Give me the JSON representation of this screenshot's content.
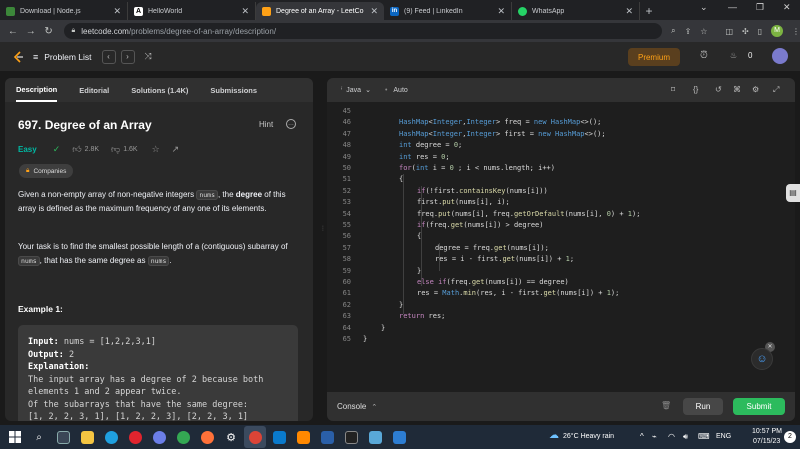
{
  "browser": {
    "tabs": [
      {
        "title": "Download | Node.js",
        "fav_color": "#3c873a"
      },
      {
        "title": "HelloWorld",
        "fav_color": "#ffffff"
      },
      {
        "title": "Degree of an Array - LeetCo",
        "fav_color": "#ffa116",
        "active": true
      },
      {
        "title": "(9) Feed | LinkedIn",
        "fav_color": "#0a66c2"
      },
      {
        "title": "WhatsApp",
        "fav_color": "#25d366"
      }
    ],
    "url_host": "leetcode.com",
    "url_path": "/problems/degree-of-an-array/description/",
    "profile_initial": "M"
  },
  "nav": {
    "problem_list": "Problem List",
    "premium": "Premium",
    "notifications": "0"
  },
  "left": {
    "tabs": [
      "Description",
      "Editorial",
      "Solutions (1.4K)",
      "Submissions"
    ],
    "title": "697. Degree of an Array",
    "hint": "Hint",
    "difficulty": "Easy",
    "likes": "2.8K",
    "dislikes": "1.6K",
    "companies": "Companies",
    "desc1_pre": "Given a non-empty array of non-negative integers ",
    "desc1_code": "nums",
    "desc1_mid": ", the ",
    "desc1_bold": "degree",
    "desc1_post": " of this array is defined as the maximum frequency of any one of its elements.",
    "desc2_pre": "Your task is to find the smallest possible length of a (contiguous) subarray of ",
    "desc2_code1": "nums",
    "desc2_mid": ", that has the same degree as ",
    "desc2_code2": "nums",
    "desc2_post": ".",
    "example_heading": "Example 1:",
    "example": {
      "input_label": "Input:",
      "input": " nums = [1,2,2,3,1]",
      "output_label": "Output:",
      "output": " 2",
      "explanation_label": "Explanation:",
      "lines": [
        "The input array has a degree of 2 because both",
        "elements 1 and 2 appear twice.",
        "Of the subarrays that have the same degree:",
        "[1, 2, 2, 3, 1], [1, 2, 2, 3], [2, 2, 3, 1]"
      ]
    }
  },
  "editor": {
    "language": "Java",
    "mode": "Auto",
    "console": "Console",
    "run": "Run",
    "submit": "Submit",
    "line_numbers": [
      "45",
      "46",
      "47",
      "48",
      "49",
      "50",
      "51",
      "52",
      "53",
      "54",
      "55",
      "56",
      "57",
      "58",
      "59",
      "60",
      "61",
      "62",
      "63",
      "64",
      "65"
    ]
  },
  "taskbar": {
    "weather": "26°C  Heavy rain",
    "lang": "ENG",
    "time": "10:57 PM",
    "date": "07/15/23"
  }
}
